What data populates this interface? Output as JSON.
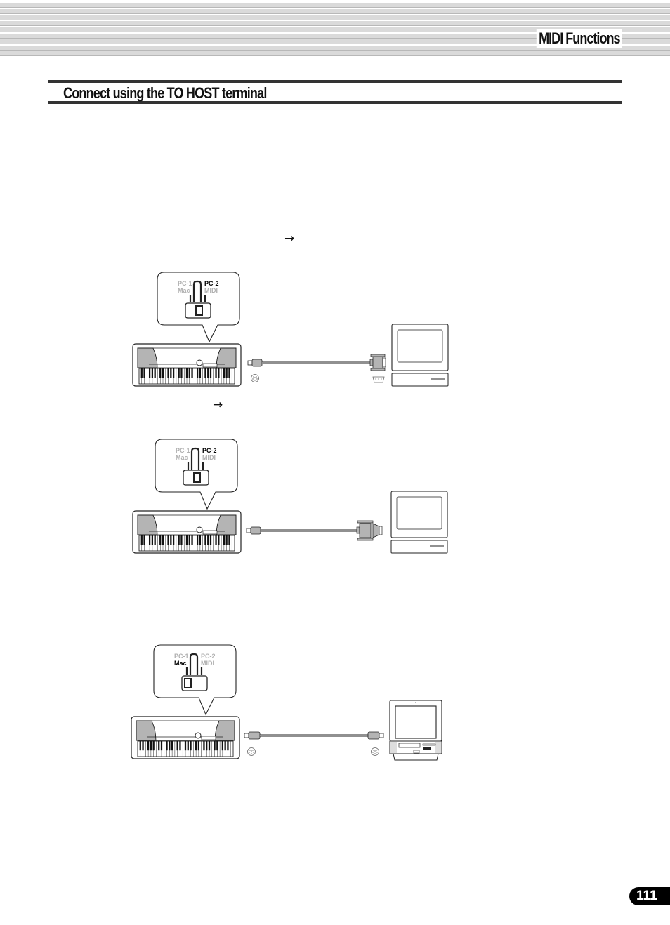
{
  "header": {
    "chapter_title": "MIDI Functions"
  },
  "section": {
    "title": "Connect using the TO HOST terminal"
  },
  "arrows": {
    "arrow_1": "→",
    "arrow_2": "→"
  },
  "diagrams": [
    {
      "name": "pc2-serial-9pin",
      "switch": {
        "labels": [
          "PC-1",
          "Mac",
          "PC-2",
          "MIDI"
        ],
        "selected": "PC-2"
      },
      "instrument": "keyboard",
      "cable": "mini-DIN 8-pin to D-SUB 9-pin",
      "computer": "pc"
    },
    {
      "name": "pc2-serial-25pin",
      "switch": {
        "labels": [
          "PC-1",
          "Mac",
          "PC-2",
          "MIDI"
        ],
        "selected": "PC-2"
      },
      "instrument": "keyboard",
      "cable": "mini-DIN 8-pin to D-SUB 9-pin with 25-pin adapter",
      "computer": "pc"
    },
    {
      "name": "mac-serial",
      "switch": {
        "labels": [
          "PC-1",
          "Mac",
          "PC-2",
          "MIDI"
        ],
        "selected": "Mac"
      },
      "instrument": "keyboard",
      "cable": "mini-DIN 8-pin to mini-DIN 8-pin",
      "computer": "macintosh"
    }
  ],
  "footer": {
    "page_number": "111"
  },
  "colors": {
    "active_label": "#000000",
    "inactive_label": "#b0b0b0",
    "connector_fill": "#b4b4b4",
    "stripe": "#dadada"
  }
}
